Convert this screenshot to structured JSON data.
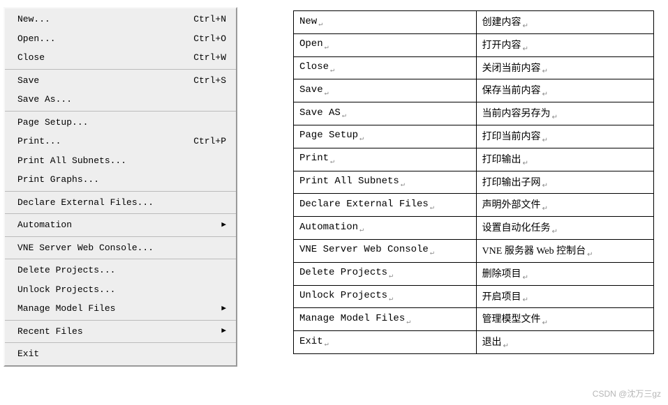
{
  "menu": {
    "sections": [
      [
        {
          "label": "New...",
          "shortcut": "Ctrl+N",
          "arrow": false
        },
        {
          "label": "Open...",
          "shortcut": "Ctrl+O",
          "arrow": false
        },
        {
          "label": "Close",
          "shortcut": "Ctrl+W",
          "arrow": false
        }
      ],
      [
        {
          "label": "Save",
          "shortcut": "Ctrl+S",
          "arrow": false
        },
        {
          "label": "Save As...",
          "shortcut": "",
          "arrow": false
        }
      ],
      [
        {
          "label": "Page Setup...",
          "shortcut": "",
          "arrow": false
        },
        {
          "label": "Print...",
          "shortcut": "Ctrl+P",
          "arrow": false
        },
        {
          "label": "Print All Subnets...",
          "shortcut": "",
          "arrow": false
        },
        {
          "label": "Print Graphs...",
          "shortcut": "",
          "arrow": false
        }
      ],
      [
        {
          "label": "Declare External Files...",
          "shortcut": "",
          "arrow": false
        }
      ],
      [
        {
          "label": "Automation",
          "shortcut": "",
          "arrow": true
        }
      ],
      [
        {
          "label": "VNE Server Web Console...",
          "shortcut": "",
          "arrow": false
        }
      ],
      [
        {
          "label": "Delete Projects...",
          "shortcut": "",
          "arrow": false
        },
        {
          "label": "Unlock Projects...",
          "shortcut": "",
          "arrow": false
        },
        {
          "label": "Manage Model Files",
          "shortcut": "",
          "arrow": true
        }
      ],
      [
        {
          "label": "Recent Files",
          "shortcut": "",
          "arrow": true
        }
      ],
      [
        {
          "label": "Exit",
          "shortcut": "",
          "arrow": false
        }
      ]
    ]
  },
  "translation": {
    "rows": [
      {
        "en": "New",
        "zh": "创建内容"
      },
      {
        "en": "Open",
        "zh": "打开内容"
      },
      {
        "en": "Close",
        "zh": "关闭当前内容"
      },
      {
        "en": "Save",
        "zh": "保存当前内容"
      },
      {
        "en": "Save AS",
        "zh": "当前内容另存为"
      },
      {
        "en": "Page Setup",
        "zh": "打印当前内容"
      },
      {
        "en": "Print",
        "zh": "打印输出"
      },
      {
        "en": "Print All Subnets",
        "zh": "打印输出子网"
      },
      {
        "en": "Declare External Files",
        "zh": "声明外部文件"
      },
      {
        "en": "Automation",
        "zh": "设置自动化任务"
      },
      {
        "en": "VNE Server Web Console",
        "zh": "VNE 服务器 Web 控制台"
      },
      {
        "en": "Delete Projects",
        "zh": "删除项目"
      },
      {
        "en": "Unlock Projects",
        "zh": "开启项目"
      },
      {
        "en": "Manage Model Files",
        "zh": "管理模型文件"
      },
      {
        "en": "Exit",
        "zh": "退出"
      }
    ],
    "paragraph_mark": "↵"
  },
  "watermark": "CSDN @沈万三gz",
  "arrow_glyph": "▶"
}
